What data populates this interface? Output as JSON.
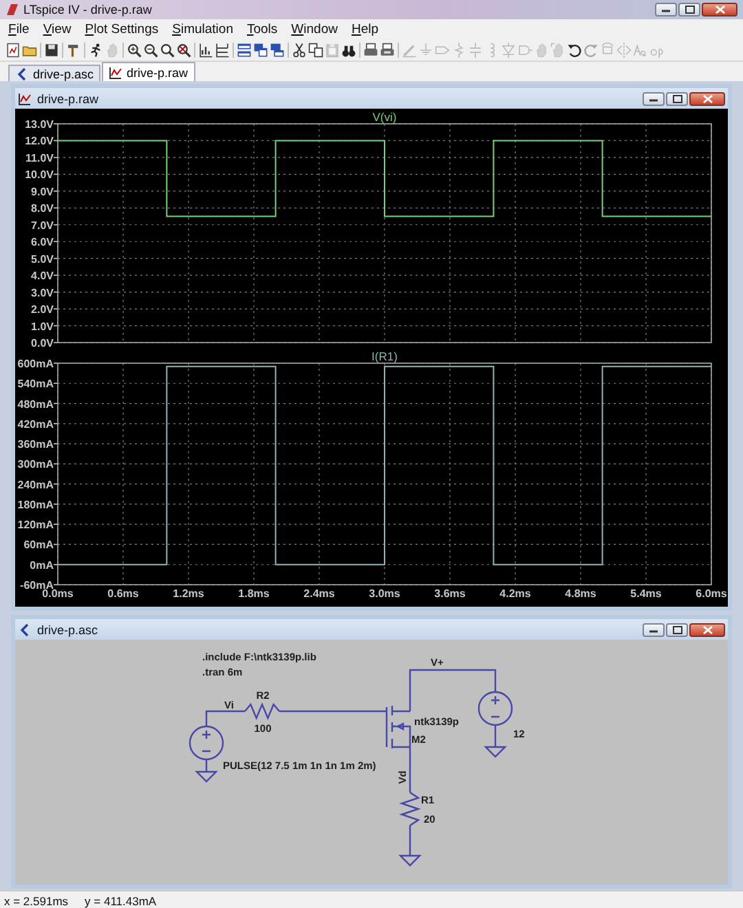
{
  "window": {
    "title": "LTspice IV - drive-p.raw"
  },
  "menu": [
    "File",
    "View",
    "Plot Settings",
    "Simulation",
    "Tools",
    "Window",
    "Help"
  ],
  "toolbar": [
    [
      {
        "kind": "new",
        "disabled": false
      },
      {
        "kind": "open",
        "disabled": false
      }
    ],
    [
      {
        "kind": "save",
        "disabled": false
      }
    ],
    [
      {
        "kind": "hammer",
        "disabled": false
      }
    ],
    [
      {
        "kind": "run",
        "disabled": false
      },
      {
        "kind": "halt",
        "disabled": true
      }
    ],
    [
      {
        "kind": "zoom_in",
        "disabled": false
      },
      {
        "kind": "zoom_out",
        "disabled": false
      },
      {
        "kind": "zoom_fit",
        "disabled": false
      },
      {
        "kind": "zoom_cancel",
        "disabled": false
      }
    ],
    [
      {
        "kind": "autorange",
        "disabled": false
      },
      {
        "kind": "axes",
        "disabled": false
      }
    ],
    [
      {
        "kind": "tile_h",
        "disabled": false
      },
      {
        "kind": "cascade",
        "disabled": false
      },
      {
        "kind": "tile_v",
        "disabled": false
      }
    ],
    [
      {
        "kind": "cut",
        "disabled": false
      },
      {
        "kind": "copy",
        "disabled": false
      },
      {
        "kind": "paste",
        "disabled": true
      },
      {
        "kind": "find",
        "disabled": false
      }
    ],
    [
      {
        "kind": "print_setup",
        "disabled": false
      },
      {
        "kind": "print",
        "disabled": false
      }
    ],
    [
      {
        "kind": "wire",
        "disabled": true
      },
      {
        "kind": "ground",
        "disabled": true
      },
      {
        "kind": "label",
        "disabled": true
      },
      {
        "kind": "resistor",
        "disabled": true
      },
      {
        "kind": "capacitor",
        "disabled": true
      },
      {
        "kind": "inductor",
        "disabled": true
      },
      {
        "kind": "diode",
        "disabled": true
      },
      {
        "kind": "component",
        "disabled": true
      },
      {
        "kind": "move",
        "disabled": true
      },
      {
        "kind": "drag",
        "disabled": true
      },
      {
        "kind": "undo",
        "disabled": false
      },
      {
        "kind": "redo",
        "disabled": true
      },
      {
        "kind": "rotate",
        "disabled": true
      },
      {
        "kind": "mirror",
        "disabled": true
      },
      {
        "kind": "text",
        "disabled": true
      },
      {
        "kind": "spice",
        "disabled": true
      }
    ]
  ],
  "tabs": [
    {
      "label": "drive-p.asc",
      "kind": "schematic",
      "selected": false
    },
    {
      "label": "drive-p.raw",
      "kind": "waveform",
      "selected": true
    }
  ],
  "plot_window": {
    "title": "drive-p.raw",
    "panes": [
      {
        "chart_data": {
          "type": "line",
          "title": "V(vi)",
          "x": [
            0,
            1,
            1,
            2,
            2,
            3,
            3,
            4,
            4,
            5,
            5,
            6
          ],
          "series": [
            {
              "color": "#7ccf7c",
              "values": [
                12,
                12,
                7.5,
                7.5,
                12,
                12,
                7.5,
                7.5,
                12,
                12,
                7.5,
                7.5
              ]
            }
          ],
          "xlim": [
            0,
            6
          ],
          "ylim": [
            0,
            13
          ],
          "grid": true,
          "yticks": [
            {
              "value": 13,
              "label": "13.0V"
            },
            {
              "value": 12,
              "label": "12.0V"
            },
            {
              "value": 11,
              "label": "11.0V"
            },
            {
              "value": 10,
              "label": "10.0V"
            },
            {
              "value": 9,
              "label": "9.0V"
            },
            {
              "value": 8,
              "label": "8.0V"
            },
            {
              "value": 7,
              "label": "7.0V"
            },
            {
              "value": 6,
              "label": "6.0V"
            },
            {
              "value": 5,
              "label": "5.0V"
            },
            {
              "value": 4,
              "label": "4.0V"
            },
            {
              "value": 3,
              "label": "3.0V"
            },
            {
              "value": 2,
              "label": "2.0V"
            },
            {
              "value": 1,
              "label": "1.0V"
            },
            {
              "value": 0,
              "label": "0.0V"
            }
          ]
        }
      },
      {
        "chart_data": {
          "type": "line",
          "title": "I(R1)",
          "x": [
            0,
            1,
            1,
            2,
            2,
            3,
            3,
            4,
            4,
            5,
            5,
            6
          ],
          "series": [
            {
              "color": "#8fb4b4",
              "values": [
                0,
                0,
                590,
                590,
                0,
                0,
                590,
                590,
                0,
                0,
                590,
                590
              ]
            }
          ],
          "xlim": [
            0,
            6
          ],
          "ylim": [
            -60,
            600
          ],
          "grid": true,
          "xticks": [
            {
              "value": 0,
              "label": "0.0ms"
            },
            {
              "value": 0.6,
              "label": "0.6ms"
            },
            {
              "value": 1.2,
              "label": "1.2ms"
            },
            {
              "value": 1.8,
              "label": "1.8ms"
            },
            {
              "value": 2.4,
              "label": "2.4ms"
            },
            {
              "value": 3,
              "label": "3.0ms"
            },
            {
              "value": 3.6,
              "label": "3.6ms"
            },
            {
              "value": 4.2,
              "label": "4.2ms"
            },
            {
              "value": 4.8,
              "label": "4.8ms"
            },
            {
              "value": 5.4,
              "label": "5.4ms"
            },
            {
              "value": 6,
              "label": "6.0ms"
            }
          ],
          "yticks": [
            {
              "value": 600,
              "label": "600mA"
            },
            {
              "value": 540,
              "label": "540mA"
            },
            {
              "value": 480,
              "label": "480mA"
            },
            {
              "value": 420,
              "label": "420mA"
            },
            {
              "value": 360,
              "label": "360mA"
            },
            {
              "value": 300,
              "label": "300mA"
            },
            {
              "value": 240,
              "label": "240mA"
            },
            {
              "value": 180,
              "label": "180mA"
            },
            {
              "value": 120,
              "label": "120mA"
            },
            {
              "value": 60,
              "label": "60mA"
            },
            {
              "value": 0,
              "label": "0mA"
            },
            {
              "value": -60,
              "label": "-60mA"
            }
          ]
        }
      }
    ]
  },
  "schematic_window": {
    "title": "drive-p.asc",
    "directives": [
      ".include F:\\ntk3139p.lib",
      ".tran 6m"
    ],
    "net_labels": [
      "Vi",
      "V+",
      "Vd"
    ],
    "components": [
      {
        "kind": "voltage_source",
        "value": "PULSE(12 7.5 1m 1n 1n 1m 2m)"
      },
      {
        "kind": "resistor",
        "name": "R2",
        "value": "100"
      },
      {
        "kind": "pmos",
        "name": "M2",
        "model": "ntk3139p"
      },
      {
        "kind": "voltage_source",
        "value": "12"
      },
      {
        "kind": "resistor",
        "name": "R1",
        "value": "20"
      }
    ]
  },
  "status_bar": [
    "x = 2.591ms",
    "y = 411.43mA"
  ]
}
